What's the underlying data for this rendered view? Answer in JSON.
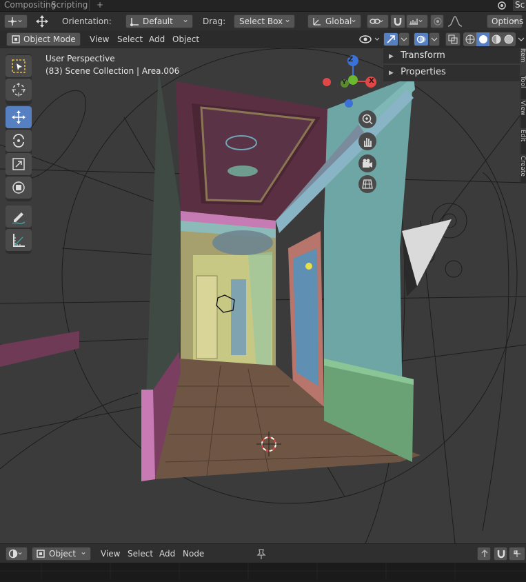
{
  "workspace_tabs": [
    "Compositing",
    "Scripting",
    "+"
  ],
  "top_right_fragment": "Sc",
  "header": {
    "orientation_label": "Orientation:",
    "orientation_value": "Default",
    "drag_label": "Drag:",
    "drag_value": "Select Box",
    "transform_space": "Global",
    "options_label": "Options"
  },
  "header2": {
    "mode": "Object Mode",
    "menus": [
      "View",
      "Select",
      "Add",
      "Object"
    ]
  },
  "viewport": {
    "perspective": "User Perspective",
    "collection": "(83) Scene Collection | Area.006"
  },
  "gizmo": {
    "axis_z": "Z",
    "axis_y": "Y",
    "axis_x": "X"
  },
  "sidebar": {
    "panels": [
      "Transform",
      "Properties"
    ],
    "tabs": [
      "Item",
      "Tool",
      "View",
      "Edit",
      "Create"
    ]
  },
  "bottom_bar": {
    "mode": "Object",
    "menus": [
      "View",
      "Select",
      "Add",
      "Node"
    ]
  },
  "colors": {
    "accent": "#5680c2",
    "viewport_bg": "#3b3b3b",
    "header_bg": "#2f2f2f",
    "floor": "#6e5544",
    "wall_teal": "#6da6a4",
    "wall_magenta": "#6e3a55",
    "wall_yellow": "#c8c885",
    "trim_green": "#6aa276",
    "trim_pink": "#c87ab4"
  }
}
